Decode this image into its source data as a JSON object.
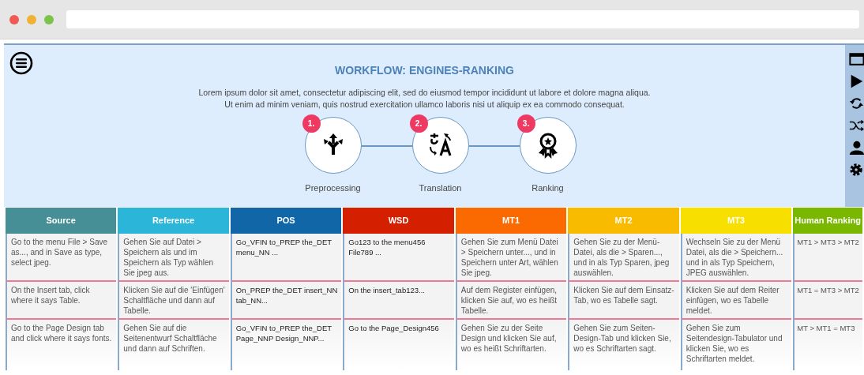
{
  "workflow": {
    "title": "WORKFLOW: ENGINES-RANKING",
    "description": "Lorem ipsum dolor sit amet, consectetur adipiscing elit, sed do eiusmod tempor incididunt ut labore et dolore magna aliqua. Ut enim ad minim veniam, quis nostrud exercitation ullamco laboris nisi ut aliquip ex ea commodo consequat.",
    "steps": [
      {
        "number": "1.",
        "label": "Preprocessing",
        "kind": "fork"
      },
      {
        "number": "2.",
        "label": "Translation",
        "kind": "translate"
      },
      {
        "number": "3.",
        "label": "Ranking",
        "kind": "award"
      }
    ]
  },
  "sidebar": {
    "items": [
      {
        "kind": "window"
      },
      {
        "kind": "play"
      },
      {
        "kind": "refresh"
      },
      {
        "kind": "shuffle"
      },
      {
        "kind": "user"
      },
      {
        "kind": "settings"
      }
    ]
  },
  "table": {
    "columns": [
      {
        "label": "Source",
        "color": "#478f97"
      },
      {
        "label": "Reference",
        "color": "#2ab5d9"
      },
      {
        "label": "POS",
        "color": "#1166a8"
      },
      {
        "label": "WSD",
        "color": "#d42000"
      },
      {
        "label": "MT1",
        "color": "#fb6a00"
      },
      {
        "label": "MT2",
        "color": "#f9bb00"
      },
      {
        "label": "MT3",
        "color": "#f7e000"
      },
      {
        "label": "Human Ranking",
        "color": "#7ab800"
      }
    ],
    "rows": [
      [
        "Go to the menu File > Save as..., and in Save as type, select jpeg.",
        "Gehen Sie auf Datei > Speichern als und im Speichern als Typ wählen Sie jpeg aus.",
        "Go_VFIN to_PREP the_DET menu_NN ...",
        "Go123 to the menu456 File789 ...",
        "Gehen Sie zum Menü Datei > Speichern unter..., und in Speichern unter Art, wählen Sie jpeg.",
        "Gehen Sie zu der Menü-Datei, als die > Sparen..., und in als Typ Sparen, jpeg auswählen.",
        "Wechseln Sie zu der Menü Datei, als die > Speichern... und in als Typ Speichern, JPEG auswählen.",
        "MT1 > MT3 > MT2"
      ],
      [
        "On the Insert tab, click where it says Table.",
        "Klicken Sie auf die 'Einfügen' Schaltfläche und dann auf Tabelle.",
        "On_PREP the_DET insert_NN tab_NN...",
        "On the insert_tab123...",
        "Auf dem Register einfügen, klicken Sie auf, wo es heißt Tabelle.",
        "Klicken Sie auf dem Einsatz-Tab, wo es Tabelle sagt.",
        "Klicken Sie auf dem Reiter einfügen, wo es Tabelle meldet.",
        "MT1 = MT3 > MT2"
      ],
      [
        "Go to the Page Design tab and click where it says fonts.",
        "Gehen Sie auf die Seitenentwurf Schaltfläche und dann auf Schriften.",
        "Go_VFIN to_PREP the_DET Page_NNP Design_NNP...",
        "Go to the Page_Design456",
        "Gehen Sie zu der Seite Design und klicken Sie auf, wo es heißt Schriftarten.",
        "Gehen Sie zum Seiten-Design-Tab und klicken Sie, wo es Schriftarten sagt.",
        "Gehen Sie zum Seitendesign-Tabulator und klicken Sie, wo es Schriftarten meldet.",
        "MT > MT1 = MT3"
      ]
    ]
  }
}
